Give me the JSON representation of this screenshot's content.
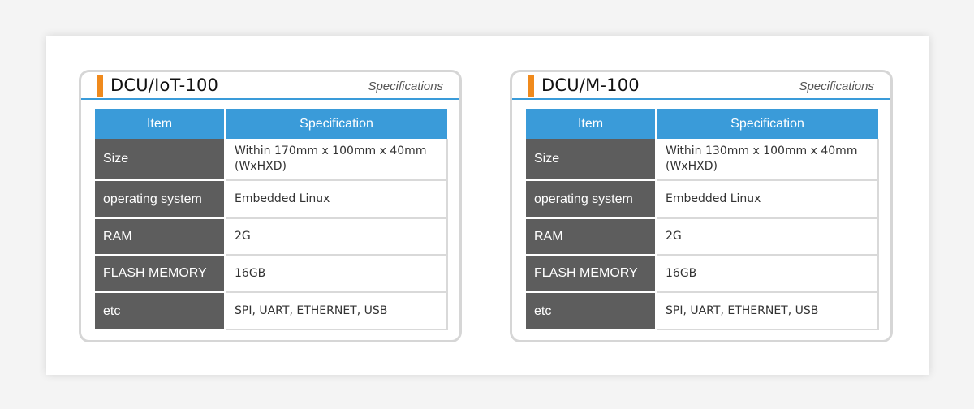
{
  "products": [
    {
      "title": "DCU/IoT-100",
      "subtitle": "Specifications",
      "headers": {
        "item": "Item",
        "spec": "Specification"
      },
      "rows": [
        {
          "item": "Size",
          "spec": "Within 170mm x 100mm x 40mm (WxHXD)"
        },
        {
          "item": "operating system",
          "spec": "Embedded Linux"
        },
        {
          "item": "RAM",
          "spec": "2G"
        },
        {
          "item": "FLASH MEMORY",
          "spec": "16GB"
        },
        {
          "item": "etc",
          "spec": "SPI, UART, ETHERNET, USB"
        }
      ]
    },
    {
      "title": "DCU/M-100",
      "subtitle": "Specifications",
      "headers": {
        "item": "Item",
        "spec": "Specification"
      },
      "rows": [
        {
          "item": "Size",
          "spec": "Within 130mm x 100mm x 40mm (WxHXD)"
        },
        {
          "item": "operating system",
          "spec": "Embedded Linux"
        },
        {
          "item": "RAM",
          "spec": "2G"
        },
        {
          "item": "FLASH MEMORY",
          "spec": "16GB"
        },
        {
          "item": "etc",
          "spec": "SPI, UART, ETHERNET, USB"
        }
      ]
    }
  ],
  "colors": {
    "accent": "#f08a1c",
    "header_blue": "#3a9bd9",
    "item_gray": "#5d5d5d",
    "card_border": "#d6d6d6"
  }
}
